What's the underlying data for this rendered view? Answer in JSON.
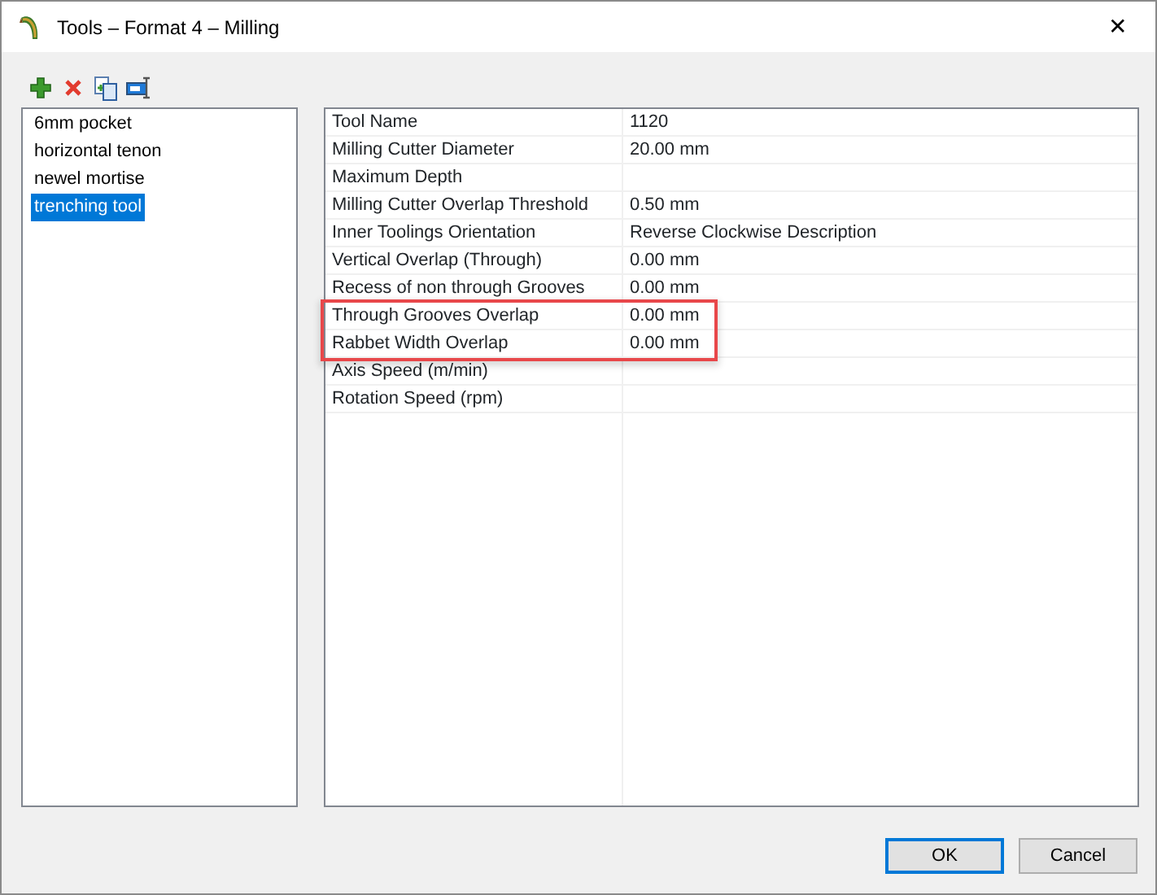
{
  "window": {
    "title": "Tools – Format 4 – Milling",
    "close": "✕"
  },
  "toolbar": [
    {
      "kind": "add"
    },
    {
      "kind": "delete"
    },
    {
      "kind": "copy"
    },
    {
      "kind": "rename"
    }
  ],
  "tools": [
    {
      "label": "6mm pocket",
      "selected": false
    },
    {
      "label": "horizontal tenon",
      "selected": false
    },
    {
      "label": "newel mortise",
      "selected": false
    },
    {
      "label": "trenching tool",
      "selected": true
    }
  ],
  "properties": [
    {
      "name": "Tool Name",
      "value": "1120",
      "highlighted": false
    },
    {
      "name": "Milling Cutter Diameter",
      "value": "20.00 mm",
      "highlighted": false
    },
    {
      "name": "Maximum Depth",
      "highlighted": false
    },
    {
      "name": "Milling Cutter Overlap Threshold",
      "value": "0.50 mm",
      "highlighted": false
    },
    {
      "name": "Inner Toolings Orientation",
      "value": "Reverse Clockwise Description",
      "highlighted": false
    },
    {
      "name": "Vertical Overlap (Through)",
      "value": "0.00 mm",
      "highlighted": false
    },
    {
      "name": "Recess of non through Grooves",
      "value": "0.00 mm",
      "highlighted": false
    },
    {
      "name": "Through Grooves Overlap",
      "value": "0.00 mm",
      "highlighted": true
    },
    {
      "name": "Rabbet Width Overlap",
      "value": "0.00 mm",
      "highlighted": true
    },
    {
      "name": "Axis Speed (m/min)",
      "highlighted": false
    },
    {
      "name": "Rotation Speed (rpm)",
      "highlighted": false
    }
  ],
  "buttons": [
    {
      "label": "OK",
      "default": true
    },
    {
      "label": "Cancel",
      "default": false
    }
  ]
}
